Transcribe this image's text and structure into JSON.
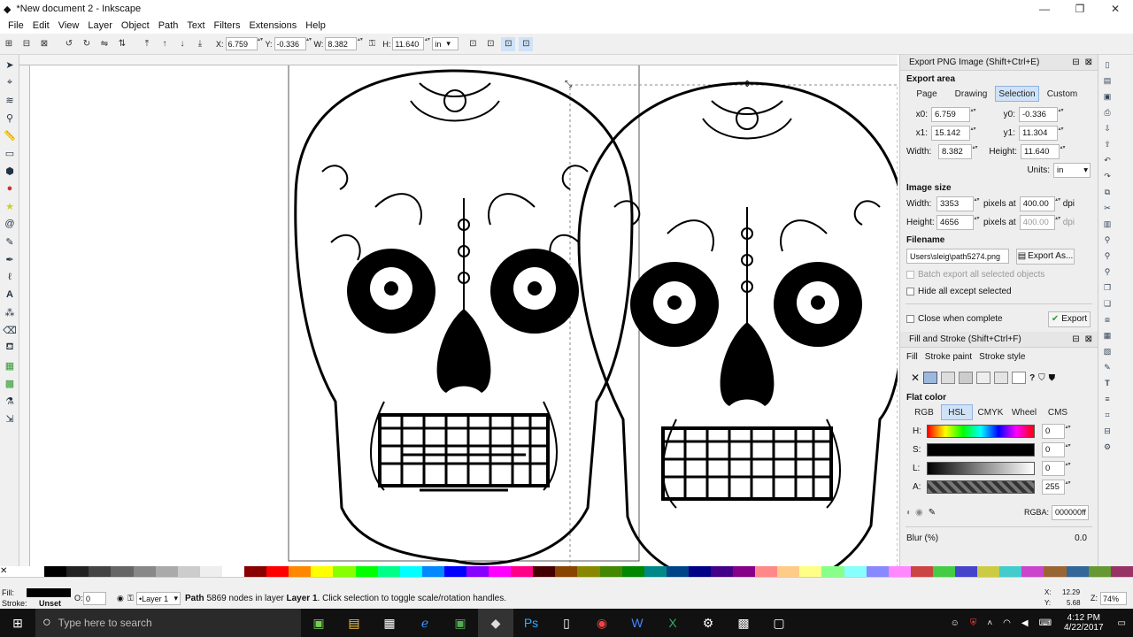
{
  "window": {
    "title": "*New document 2 - Inkscape",
    "min": "—",
    "max": "❐",
    "close": "✕"
  },
  "menu": [
    "File",
    "Edit",
    "View",
    "Layer",
    "Object",
    "Path",
    "Text",
    "Filters",
    "Extensions",
    "Help"
  ],
  "toolbar": {
    "x_label": "X:",
    "x_value": "6.759",
    "y_label": "Y:",
    "y_value": "-0.336",
    "w_label": "W:",
    "w_value": "8.382",
    "h_label": "H:",
    "h_value": "11.640",
    "unit": "in"
  },
  "export": {
    "header": "Export PNG Image (Shift+Ctrl+E)",
    "area_title": "Export area",
    "tabs": [
      "Page",
      "Drawing",
      "Selection",
      "Custom"
    ],
    "selected_tab": "Selection",
    "x0_label": "x0:",
    "x0": "6.759",
    "y0_label": "y0:",
    "y0": "-0.336",
    "x1_label": "x1:",
    "x1": "15.142",
    "y1_label": "y1:",
    "y1": "11.304",
    "width_label": "Width:",
    "width": "8.382",
    "height_label": "Height:",
    "height": "11.640",
    "units_label": "Units:",
    "units": "in",
    "image_size_title": "Image size",
    "img_width_label": "Width:",
    "img_width": "3353",
    "img_height_label": "Height:",
    "img_height": "4656",
    "pixels_at": "pixels at",
    "dpi_value": "400.00",
    "dpi_value2": "400.00",
    "dpi": "dpi",
    "filename_title": "Filename",
    "filename": "Users\\sleig\\path5274.png",
    "export_as": "Export As...",
    "batch": "Batch export all selected objects",
    "hide_all": "Hide all except selected",
    "close_when": "Close when complete",
    "export_btn": "Export"
  },
  "fill": {
    "header": "Fill and Stroke (Shift+Ctrl+F)",
    "tabs": [
      "Fill",
      "Stroke paint",
      "Stroke style"
    ],
    "flat_color": "Flat color",
    "modes": [
      "RGB",
      "HSL",
      "CMYK",
      "Wheel",
      "CMS"
    ],
    "selected_mode": "HSL",
    "h_label": "H:",
    "h": "0",
    "s_label": "S:",
    "s": "0",
    "l_label": "L:",
    "l": "0",
    "a_label": "A:",
    "a": "255",
    "rgba_label": "RGBA:",
    "rgba": "000000ff",
    "blur_label": "Blur (%)",
    "blur": "0.0"
  },
  "status": {
    "fill_label": "Fill:",
    "stroke_label": "Stroke:",
    "stroke_value": "Unset",
    "opacity_label": "O:",
    "opacity": "0",
    "layer": "•Layer 1",
    "message_strong": "Path",
    "message": " 5869 nodes in layer ",
    "message_layer": "Layer 1",
    "message_tail": ". Click selection to toggle scale/rotation handles.",
    "cx_label": "X:",
    "cx": "12.29",
    "cy_label": "Y:",
    "cy": "5.68",
    "zoom_label": "Z:",
    "zoom": "74%"
  },
  "taskbar": {
    "search": "Type here to search",
    "time": "4:12 PM",
    "date": "4/22/2017"
  },
  "colors": {
    "accent": "#cfe2f7",
    "taskbar": "#111111"
  }
}
